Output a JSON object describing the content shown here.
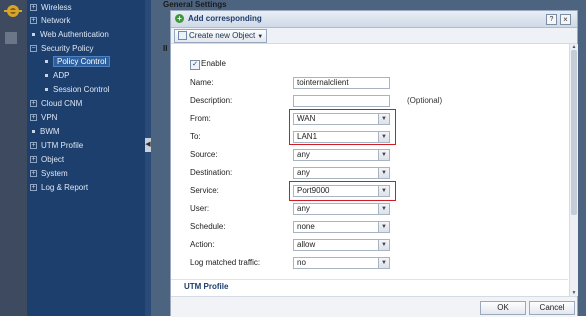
{
  "nav": {
    "items": [
      {
        "label": "Wireless",
        "kind": "plus"
      },
      {
        "label": "Network",
        "kind": "plus"
      },
      {
        "label": "Web Authentication",
        "kind": "dot"
      },
      {
        "label": "Security Policy",
        "kind": "minus"
      },
      {
        "label": "Policy Control",
        "kind": "child-active"
      },
      {
        "label": "ADP",
        "kind": "child"
      },
      {
        "label": "Session Control",
        "kind": "child"
      },
      {
        "label": "Cloud CNM",
        "kind": "plus"
      },
      {
        "label": "VPN",
        "kind": "plus"
      },
      {
        "label": "BWM",
        "kind": "dot"
      },
      {
        "label": "UTM Profile",
        "kind": "plus"
      },
      {
        "label": "Object",
        "kind": "plus"
      },
      {
        "label": "System",
        "kind": "plus"
      },
      {
        "label": "Log & Report",
        "kind": "plus"
      }
    ]
  },
  "main": {
    "section_title": "General Settings",
    "section_title_2": "II"
  },
  "dialog": {
    "title": "Add corresponding",
    "help_label": "?",
    "close_label": "×",
    "toolbar": {
      "create_label": "Create new Object"
    },
    "enable_label": "Enable",
    "enable_checked": true,
    "name_label": "Name:",
    "name_value": "tointernalclient",
    "description_label": "Description:",
    "description_value": "",
    "optional_label": "(Optional)",
    "from_label": "From:",
    "from_value": "WAN",
    "to_label": "To:",
    "to_value": "LAN1",
    "source_label": "Source:",
    "source_value": "any",
    "destination_label": "Destination:",
    "destination_value": "any",
    "service_label": "Service:",
    "service_value": "Port9000",
    "user_label": "User:",
    "user_value": "any",
    "schedule_label": "Schedule:",
    "schedule_value": "none",
    "action_label": "Action:",
    "action_value": "allow",
    "log_label": "Log matched traffic:",
    "log_value": "no",
    "utm_section": "UTM Profile",
    "ok_label": "OK",
    "cancel_label": "Cancel"
  },
  "colors": {
    "highlight": "#d01c24",
    "nav_bg": "#1c3f6e",
    "main_bg": "#4d6481"
  },
  "icons": [
    "logo-icon",
    "add-icon",
    "help-icon",
    "close-icon",
    "new-object-icon",
    "dropdown-arrow-icon",
    "collapse-arrow-icon"
  ]
}
